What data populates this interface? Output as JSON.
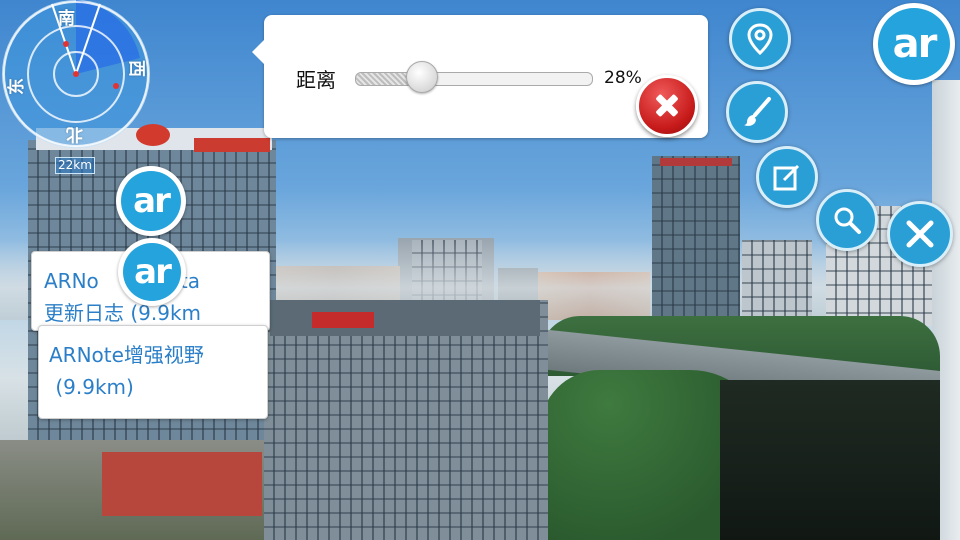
{
  "radar": {
    "north": "北",
    "south": "南",
    "east": "东",
    "west": "西",
    "range": "22km"
  },
  "distance_panel": {
    "label": "距离",
    "value": "28%",
    "level": 0.28
  },
  "poi": [
    {
      "line1": "ARNo",
      "line1_tail": ".0Beta",
      "line2": "更新日志 (9.9km"
    },
    {
      "line1": "ARNote增强视野",
      "line2": " (9.9km)"
    }
  ],
  "ar_logo_text": "ar",
  "toolbar": {
    "location": "location-pin-icon",
    "brush": "brush-icon",
    "edit": "edit-note-icon",
    "search": "search-icon",
    "close": "close-icon"
  },
  "colors": {
    "accent": "#2a9fd6",
    "poi_text": "#2b7fc8",
    "close_red": "#c71a1a"
  }
}
